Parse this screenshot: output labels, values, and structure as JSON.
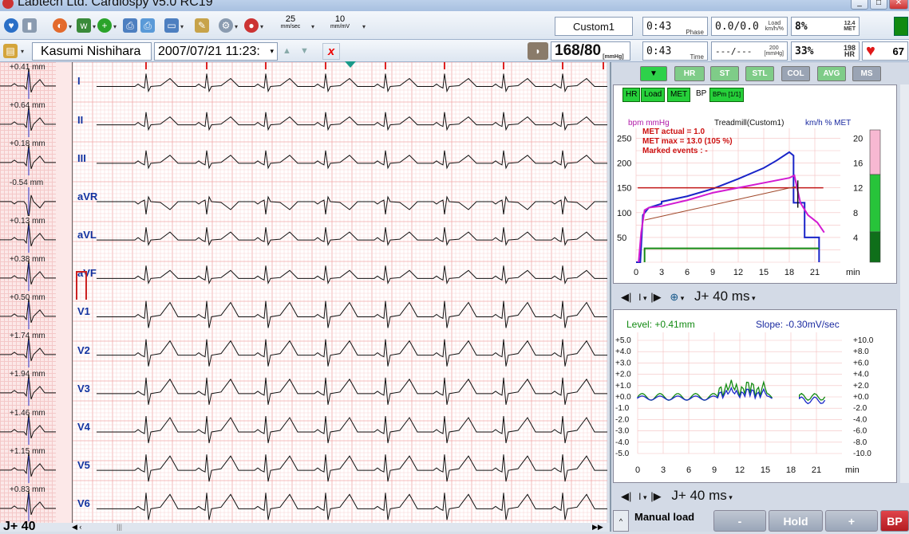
{
  "window": {
    "title": "Labtech Ltd. Cardiospy v5.0 RC19"
  },
  "toolbar": {
    "speed_value": "25",
    "speed_unit": "mm/sec",
    "gain_value": "10",
    "gain_unit": "mm/mV"
  },
  "status": {
    "protocol": "Custom1",
    "phase_time": "0:43",
    "phase_label": "Phase",
    "load_value": "0.0/0.0",
    "load_unit_top": "Load",
    "load_unit_bottom": "km/h/%",
    "met_pct": "8%",
    "met_value": "12.4",
    "met_label": "MET",
    "bp_value": "168/80",
    "bp_unit": "[mmHg]",
    "total_time": "0:43",
    "time_label": "Time",
    "bp_extra": "---/---",
    "bp_extra_top": "200",
    "bp_extra_unit": "[mmHg]",
    "hr_pct": "33%",
    "hr_max": "198",
    "hr_label": "HR",
    "heart_rate": "67"
  },
  "patient": {
    "name": "Kasumi Nishihara",
    "datetime": "2007/07/21 11:23:"
  },
  "st_levels": [
    "+0.41 mm",
    "+0.64 mm",
    "+0.18 mm",
    "-0.54 mm",
    "+0.13 mm",
    "+0.38 mm",
    "+0.50 mm",
    "+1.74 mm",
    "+1.94 mm",
    "+1.46 mm",
    "+1.15 mm",
    "+0.83 mm"
  ],
  "leads": [
    "I",
    "II",
    "III",
    "aVR",
    "aVL",
    "aVF",
    "V1",
    "V2",
    "V3",
    "V4",
    "V5",
    "V6"
  ],
  "footer": {
    "j_point": "J+ 40"
  },
  "view_buttons": {
    "hr": "HR",
    "st": "ST",
    "stl": "STL",
    "col": "COL",
    "avg": "AVG",
    "ms": "MS"
  },
  "chart_tabs": {
    "hr": "HR",
    "load": "Load",
    "met": "MET",
    "bp": "BP",
    "bpm": "BPm [1/1]"
  },
  "trend_chart": {
    "left_units": "bpm  mmHg",
    "protocol": "Treadmill(Custom1)",
    "right_units": "km/h  %  MET",
    "met_actual": "MET actual = 1.0",
    "met_max": "MET max = 13.0 (105 %)",
    "events": "Marked events : -",
    "y_ticks_left": [
      "250",
      "200",
      "150",
      "100",
      "50"
    ],
    "y_ticks_right": [
      "20",
      "16",
      "12",
      "8",
      "4"
    ],
    "x_ticks": [
      "0",
      "3",
      "6",
      "9",
      "12",
      "15",
      "18",
      "21"
    ],
    "x_unit": "min"
  },
  "st_panel": {
    "lead": "I",
    "jpoint": "J+ 40 ms",
    "level": "Level: +0.41mm",
    "slope": "Slope: -0.30mV/sec",
    "y_left": [
      "+5.0",
      "+4.0",
      "+3.0",
      "+2.0",
      "+1.0",
      "+0.0",
      "-1.0",
      "-2.0",
      "-3.0",
      "-4.0",
      "-5.0"
    ],
    "y_right": [
      "+10.0",
      "+8.0",
      "+6.0",
      "+4.0",
      "+2.0",
      "+0.0",
      "-2.0",
      "-4.0",
      "-6.0",
      "-8.0",
      "-10.0"
    ],
    "x_ticks": [
      "0",
      "3",
      "6",
      "9",
      "12",
      "15",
      "18",
      "21"
    ],
    "x_unit": "min"
  },
  "bottom_panel": {
    "lead": "I",
    "jpoint": "J+ 40 ms",
    "mode": "Manual load",
    "minus": "-",
    "hold": "Hold",
    "plus": "+",
    "bp": "BP"
  }
}
